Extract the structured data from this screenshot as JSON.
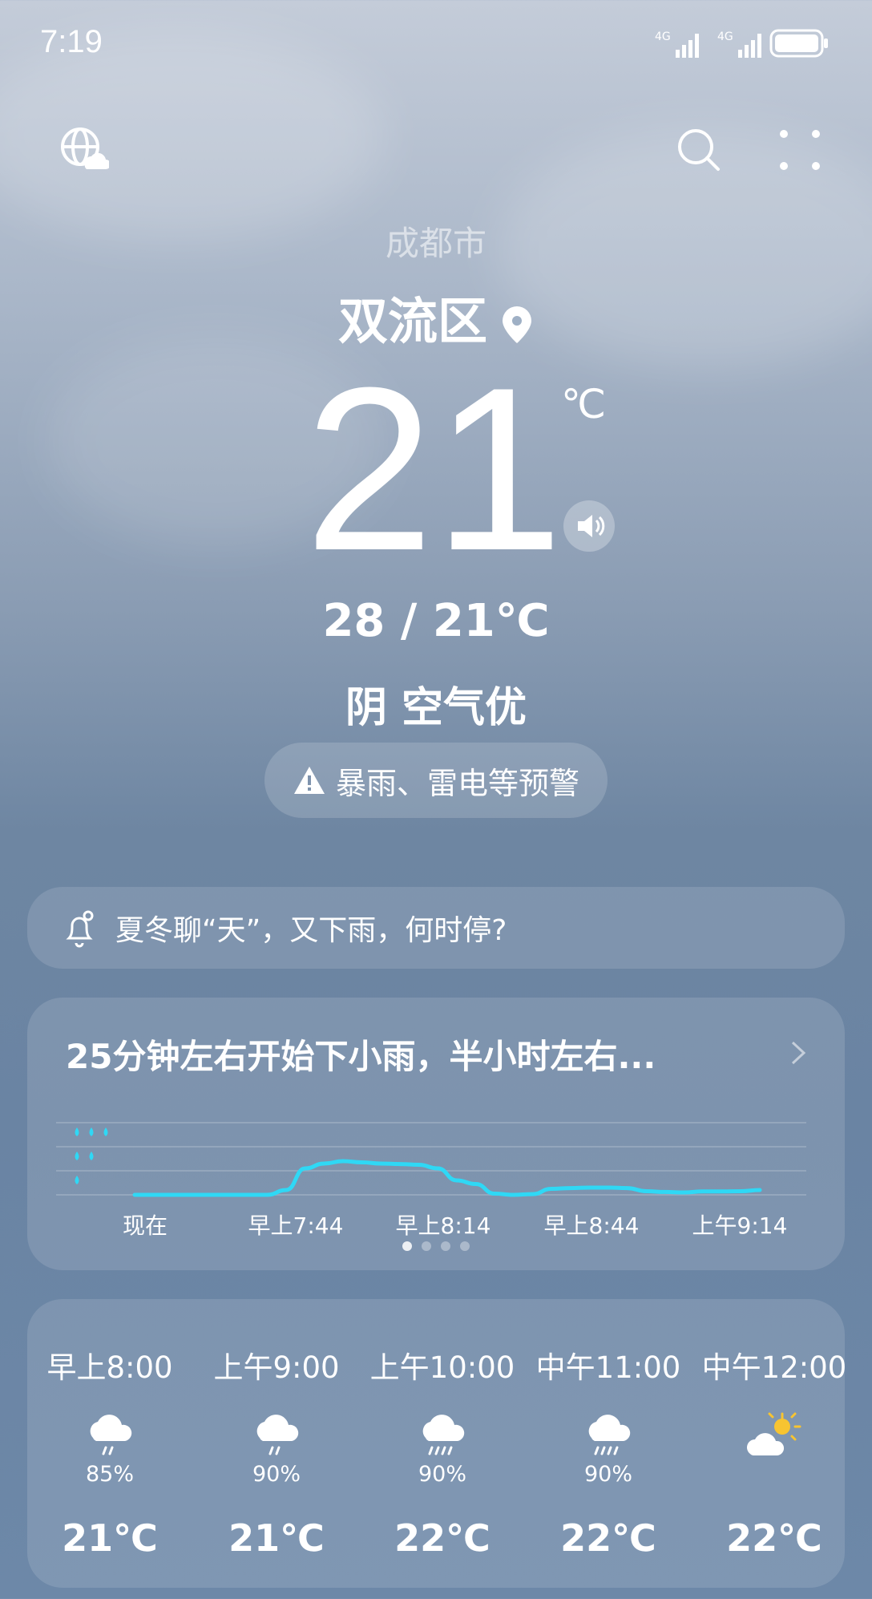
{
  "status": {
    "time": "7:19",
    "net1": "4G",
    "net2": "4G"
  },
  "location": {
    "city": "成都市",
    "district": "双流区"
  },
  "current": {
    "temp": "21",
    "unit": "℃",
    "range": "28 / 21℃",
    "condition": "阴  空气优",
    "alert": "暴雨、雷电等预警"
  },
  "news": {
    "text": "夏冬聊“天”，又下雨，何时停?"
  },
  "rain": {
    "title": "25分钟左右开始下小雨，半小时左右...",
    "ticks": [
      "现在",
      "早上7:44",
      "早上8:14",
      "早上8:44",
      "上午9:14"
    ],
    "series": [
      0,
      0,
      0,
      0,
      0,
      0,
      0,
      0,
      0.2,
      1.1,
      1.3,
      1.4,
      1.35,
      1.3,
      1.28,
      1.25,
      1.1,
      0.6,
      0.45,
      0.05,
      0,
      0.03,
      0.25,
      0.28,
      0.3,
      0.3,
      0.28,
      0.15,
      0.12,
      0.1,
      0.14,
      0.14,
      0.15,
      0.2
    ],
    "levels": 3,
    "page_dots": 4
  },
  "hourly": [
    {
      "time": "早上8:00",
      "icon": "rain-cloud-icon",
      "pop": "85%",
      "temp": "21℃"
    },
    {
      "time": "上午9:00",
      "icon": "rain-cloud-icon",
      "pop": "90%",
      "temp": "21℃"
    },
    {
      "time": "上午10:00",
      "icon": "heavy-rain-cloud-icon",
      "pop": "90%",
      "temp": "22℃"
    },
    {
      "time": "中午11:00",
      "icon": "heavy-rain-cloud-icon",
      "pop": "90%",
      "temp": "22℃"
    },
    {
      "time": "中午12:00",
      "icon": "partly-cloudy-icon",
      "pop": "",
      "temp": "22℃"
    }
  ],
  "colors": {
    "rain_line": "#2fd8f5",
    "sun": "#f7c431"
  }
}
